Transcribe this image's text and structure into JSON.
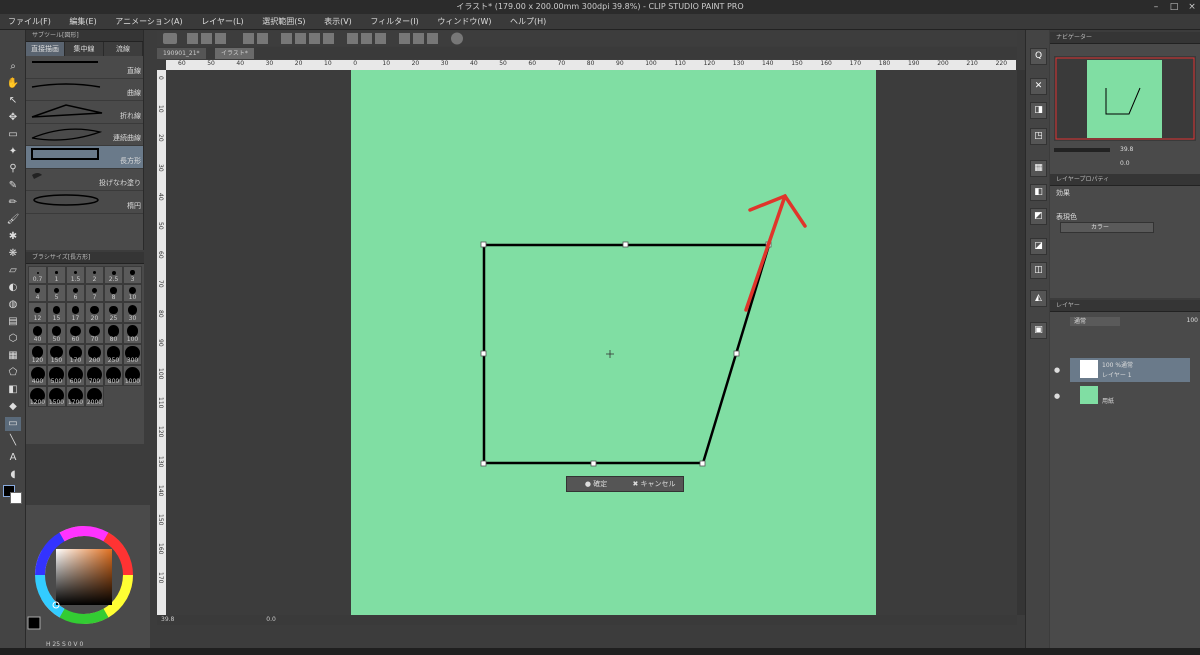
{
  "window": {
    "title": "イラスト* (179.00 x 200.00mm 300dpi 39.8%)  - CLIP STUDIO PAINT PRO"
  },
  "menu": [
    "ファイル(F)",
    "編集(E)",
    "アニメーション(A)",
    "レイヤー(L)",
    "選択範囲(S)",
    "表示(V)",
    "フィルター(I)",
    "ウィンドウ(W)",
    "ヘルプ(H)"
  ],
  "doc_tabs": [
    "190901_21*",
    "イラスト*"
  ],
  "subtool": {
    "header": "サブツール[図形]",
    "tabs": [
      "直接描画",
      "集中線",
      "流線"
    ],
    "items": [
      "直線",
      "曲線",
      "折れ線",
      "連続曲線",
      "長方形",
      "投げなわ塗り",
      "楕円"
    ],
    "selected_index": 4
  },
  "brushsize": {
    "header": "ブラシサイズ[長方形]",
    "sizes": [
      "0.7",
      "1",
      "1.5",
      "2",
      "2.5",
      "3",
      "4",
      "5",
      "6",
      "7",
      "8",
      "10",
      "12",
      "15",
      "17",
      "20",
      "25",
      "30",
      "40",
      "50",
      "60",
      "70",
      "80",
      "100",
      "120",
      "150",
      "170",
      "200",
      "250",
      "300",
      "400",
      "500",
      "600",
      "700",
      "800",
      "1000",
      "1200",
      "1500",
      "1700",
      "2000"
    ]
  },
  "ruler": {
    "top": [
      "60",
      "50",
      "40",
      "30",
      "20",
      "10",
      "0",
      "10",
      "20",
      "30",
      "40",
      "50",
      "60",
      "70",
      "80",
      "90",
      "100",
      "110",
      "120",
      "130",
      "140",
      "150",
      "160",
      "170",
      "180",
      "190",
      "200",
      "210",
      "220"
    ],
    "left": [
      "0",
      "10",
      "20",
      "30",
      "40",
      "50",
      "60",
      "70",
      "80",
      "90",
      "100",
      "110",
      "120",
      "130",
      "140",
      "150",
      "160",
      "170"
    ]
  },
  "transform": {
    "confirm_label": "確定",
    "cancel_label": "キャンセル"
  },
  "navigator": {
    "header": "ナビゲーター",
    "zoom": "39.8",
    "rotation": "0.0"
  },
  "layer_property": {
    "header": "レイヤープロパティ",
    "effect_label": "効果",
    "expression_label": "表現色",
    "expression_value": "カラー"
  },
  "layers": {
    "header": "レイヤー",
    "blend_mode": "通常",
    "opacity": "100",
    "items": [
      {
        "name": "レイヤー 1",
        "info": "100 %通常",
        "selected": true
      },
      {
        "name": "用紙",
        "info": "",
        "selected": false
      }
    ]
  },
  "color": {
    "paper": "#80dea3",
    "accent_arrow": "#e0352b",
    "hsv_h": "25",
    "hsv_s": "0",
    "hsv_v": "0"
  },
  "status": {
    "zoom": "39.8",
    "rotation": "0.0"
  }
}
